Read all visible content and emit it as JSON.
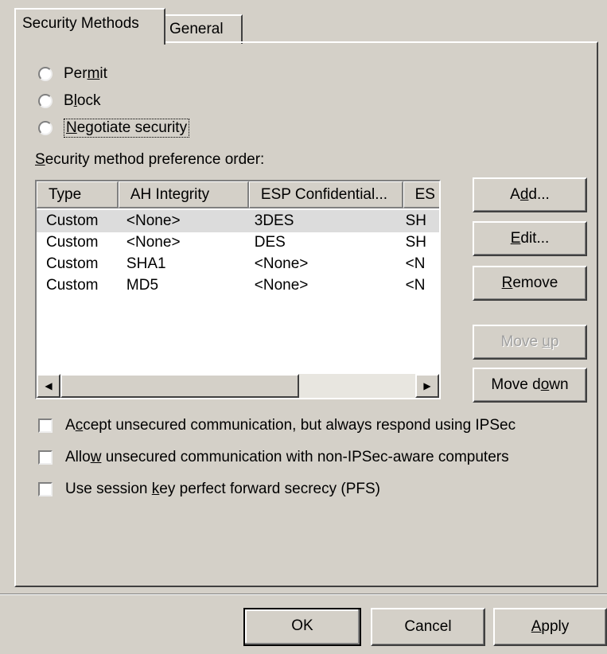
{
  "tabs": [
    {
      "label": "Security Methods",
      "active": true
    },
    {
      "label": "General",
      "active": false
    }
  ],
  "actions": {
    "permit": {
      "pre": "Per",
      "key": "m",
      "post": "it"
    },
    "block": {
      "pre": "B",
      "key": "l",
      "post": "ock"
    },
    "negotiate": {
      "pre": "",
      "key": "N",
      "post": "egotiate security"
    }
  },
  "list": {
    "caption": {
      "key": "S",
      "post": "ecurity method preference order:"
    },
    "columns": [
      "Type",
      "AH Integrity",
      "ESP Confidential...",
      "ES"
    ],
    "rows": [
      [
        "Custom",
        "<None>",
        "3DES",
        "SH"
      ],
      [
        "Custom",
        "<None>",
        "DES",
        "SH"
      ],
      [
        "Custom",
        "SHA1",
        "<None>",
        "<N"
      ],
      [
        "Custom",
        "MD5",
        "<None>",
        "<N"
      ]
    ]
  },
  "buttons": {
    "add": {
      "pre": "A",
      "key": "d",
      "post": "d..."
    },
    "edit": {
      "pre": "",
      "key": "E",
      "post": "dit..."
    },
    "remove": {
      "pre": "",
      "key": "R",
      "post": "emove"
    },
    "move_up": {
      "pre": "Move ",
      "key": "u",
      "post": "p"
    },
    "move_down": {
      "pre": "Move d",
      "key": "o",
      "post": "wn"
    }
  },
  "options": {
    "accept": {
      "pre": "A",
      "key": "c",
      "post": "cept unsecured communication, but always respond using IPSec"
    },
    "allow": {
      "pre": "Allo",
      "key": "w",
      "post": " unsecured communication with non-IPSec-aware computers"
    },
    "pfs": {
      "pre": "Use session ",
      "key": "k",
      "post": "ey perfect forward secrecy (PFS)"
    }
  },
  "dialog": {
    "ok": "OK",
    "cancel": "Cancel",
    "apply": {
      "pre": "",
      "key": "A",
      "post": "pply"
    }
  }
}
